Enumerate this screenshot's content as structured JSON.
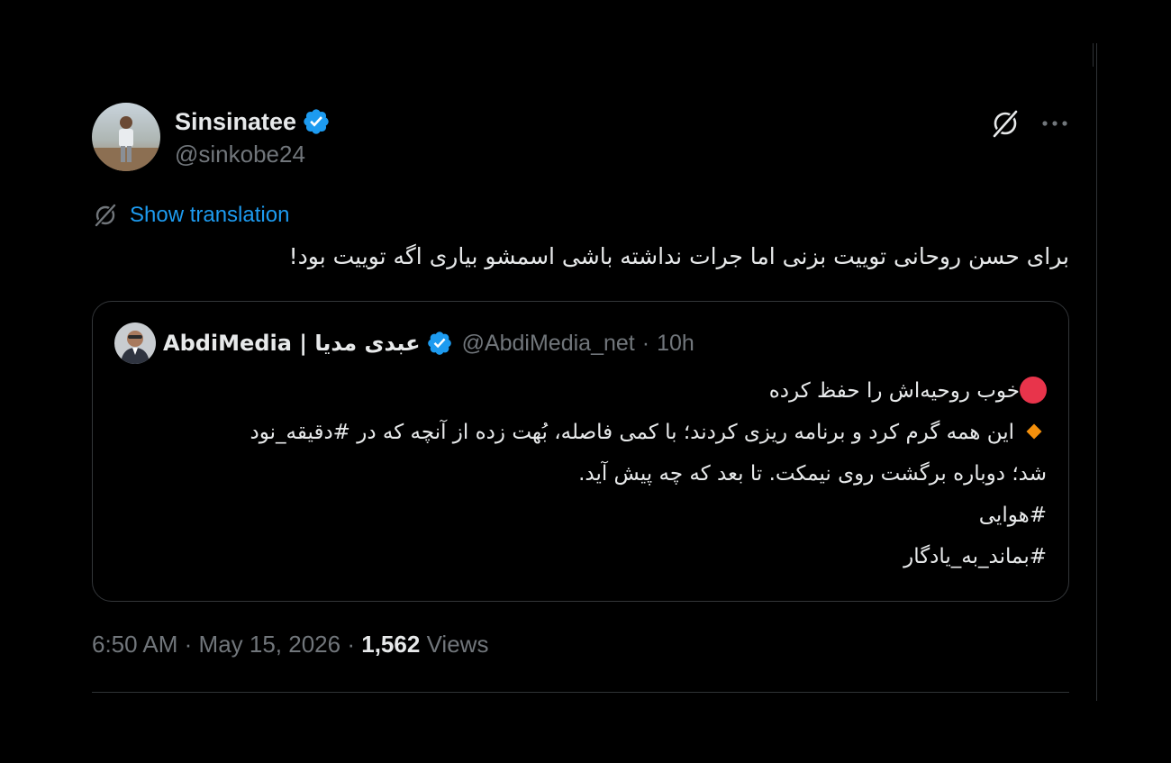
{
  "author": {
    "display_name": "Sinsinatee",
    "handle": "@sinkobe24",
    "verified": true,
    "avatar_icon": "person-on-beach-avatar"
  },
  "actions": {
    "grok_icon": "grok-icon",
    "more_icon": "more-horizontal-icon"
  },
  "translation": {
    "icon": "translate-icon",
    "label": "Show translation"
  },
  "tweet": {
    "text": "برای حسن روحانی توییت بزنی اما جرات نداشته باشی اسمشو بیاری اگه توییت بود!"
  },
  "quote": {
    "avatar_icon": "man-in-suit-avatar",
    "display_name": "AbdiMedia | عبدی مدیا",
    "verified": true,
    "handle": "@AbdiMedia_net",
    "separator": "·",
    "time": "10h",
    "lines": [
      "خوب روحیه‌اش را حفظ کرده",
      "این همه گرم کرد و برنامه ریزی کردند؛ با کمی فاصله، بُهت زده از آنچه که در #دقیقه_نود",
      "شد؛ دوباره برگشت روی نیمکت. تا بعد که چه پیش آید.",
      "#هوایی",
      "#بماند_به_یادگار"
    ]
  },
  "meta": {
    "time": "6:50 AM",
    "sep1": "·",
    "date": "May 15, 2026",
    "sep2": "·",
    "views_count": "1,562",
    "views_label": "Views"
  },
  "colors": {
    "background": "#000000",
    "text": "#e7e9ea",
    "muted": "#71767b",
    "link": "#1d9bf0",
    "verified": "#1d9bf0",
    "border": "#333639"
  }
}
